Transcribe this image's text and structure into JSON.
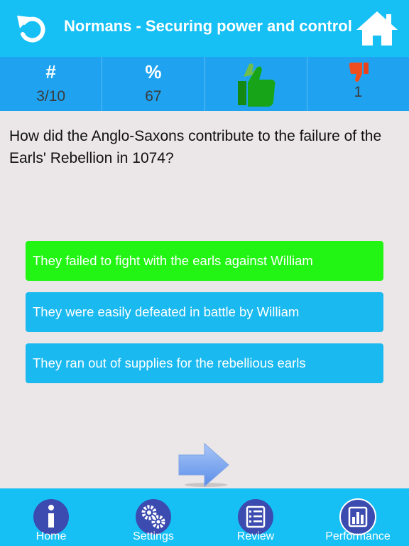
{
  "header": {
    "title": "Normans - Securing power and control",
    "back_icon": "undo-arrow-icon",
    "home_icon": "home-icon"
  },
  "stats": {
    "number_header": "#",
    "number_value": "3/10",
    "percent_header": "%",
    "percent_value": "67",
    "correct_icon": "thumbs-up-icon",
    "wrong_icon": "thumbs-down-icon",
    "wrong_value": "1"
  },
  "question": {
    "text": "How did the Anglo-Saxons contribute to the failure of the Earls' Rebellion in 1074?"
  },
  "answers": [
    {
      "text": "They failed to fight with the earls against William",
      "state": "correct"
    },
    {
      "text": "They were easily defeated in battle by William",
      "state": "normal"
    },
    {
      "text": "They ran out of supplies for the rebellious earls",
      "state": "normal"
    }
  ],
  "next": {
    "icon": "right-arrow-icon"
  },
  "tabs": [
    {
      "label": "Home",
      "icon": "info-icon"
    },
    {
      "label": "Settings",
      "icon": "gears-icon"
    },
    {
      "label": "Review",
      "icon": "checklist-icon"
    },
    {
      "label": "Performance",
      "icon": "bar-chart-icon"
    }
  ],
  "colors": {
    "header_bg": "#16c0f5",
    "stats_bg": "#1fa3f0",
    "correct_answer": "#22f513",
    "answer": "#1ab9f0",
    "tab_icon_bg": "#3b4bb0"
  }
}
